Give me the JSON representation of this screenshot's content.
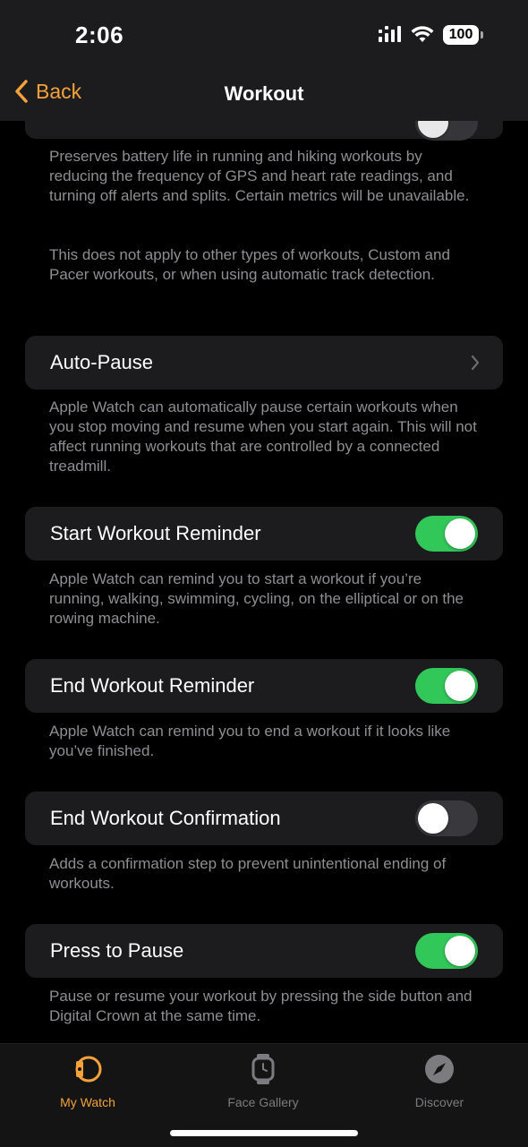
{
  "status_bar": {
    "time": "2:06",
    "battery": "100"
  },
  "nav": {
    "back_label": "Back",
    "title": "Workout"
  },
  "sections": {
    "low_power": {
      "footer_1": "Preserves battery life in running and hiking workouts by reducing the frequency of GPS and heart rate readings, and turning off alerts and splits. Certain metrics will be unavailable.",
      "footer_2": "This does not apply to other types of workouts, Custom and Pacer workouts, or when using automatic track detection."
    },
    "auto_pause": {
      "label": "Auto-Pause",
      "footer": "Apple Watch can automatically pause certain workouts when you stop moving and resume when you start again. This will not affect running workouts that are controlled by a connected treadmill."
    },
    "start_reminder": {
      "label": "Start Workout Reminder",
      "enabled": true,
      "footer": "Apple Watch can remind you to start a workout if you’re running, walking, swimming, cycling, on the elliptical or on the rowing machine."
    },
    "end_reminder": {
      "label": "End Workout Reminder",
      "enabled": true,
      "footer": "Apple Watch can remind you to end a workout if it looks like you’ve finished."
    },
    "end_confirmation": {
      "label": "End Workout Confirmation",
      "enabled": false,
      "footer": "Adds a confirmation step to prevent unintentional ending of workouts."
    },
    "press_to_pause": {
      "label": "Press to Pause",
      "enabled": true,
      "footer": "Pause or resume your workout by pressing the side button and Digital Crown at the same time."
    }
  },
  "tab_bar": {
    "tabs": [
      {
        "label": "My Watch",
        "icon": "watch-icon",
        "active": true
      },
      {
        "label": "Face Gallery",
        "icon": "watch-face-icon",
        "active": false
      },
      {
        "label": "Discover",
        "icon": "compass-icon",
        "active": false
      }
    ]
  },
  "colors": {
    "accent": "#f5a23b",
    "toggle_on": "#32c759",
    "toggle_off": "#39393d",
    "cell_bg": "#1c1c1e",
    "secondary_text": "#8e8e93"
  }
}
